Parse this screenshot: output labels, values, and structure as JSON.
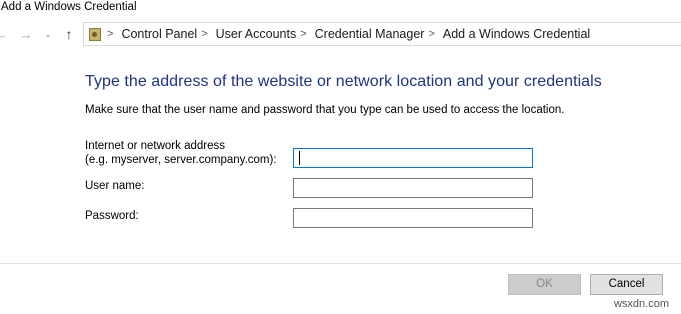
{
  "window": {
    "title": "Add a Windows Credential"
  },
  "nav": {
    "back_icon": "←",
    "forward_icon": "→",
    "recent_icon": "⌄",
    "up_icon": "↑"
  },
  "breadcrumb": {
    "items": [
      "Control Panel",
      "User Accounts",
      "Credential Manager",
      "Add a Windows Credential"
    ],
    "separator": ">"
  },
  "form": {
    "heading": "Type the address of the website or network location and your credentials",
    "description": "Make sure that the user name and password that you type can be used to access the location.",
    "address_label_line1": "Internet or network address",
    "address_label_line2": "(e.g. myserver, server.company.com):",
    "address_value": "",
    "username_label": "User name:",
    "username_value": "",
    "password_label": "Password:",
    "password_value": ""
  },
  "buttons": {
    "ok": "OK",
    "cancel": "Cancel"
  },
  "watermark": "wsxdn.com",
  "colors": {
    "heading": "#1e3287",
    "focus_border": "#0078d7"
  }
}
